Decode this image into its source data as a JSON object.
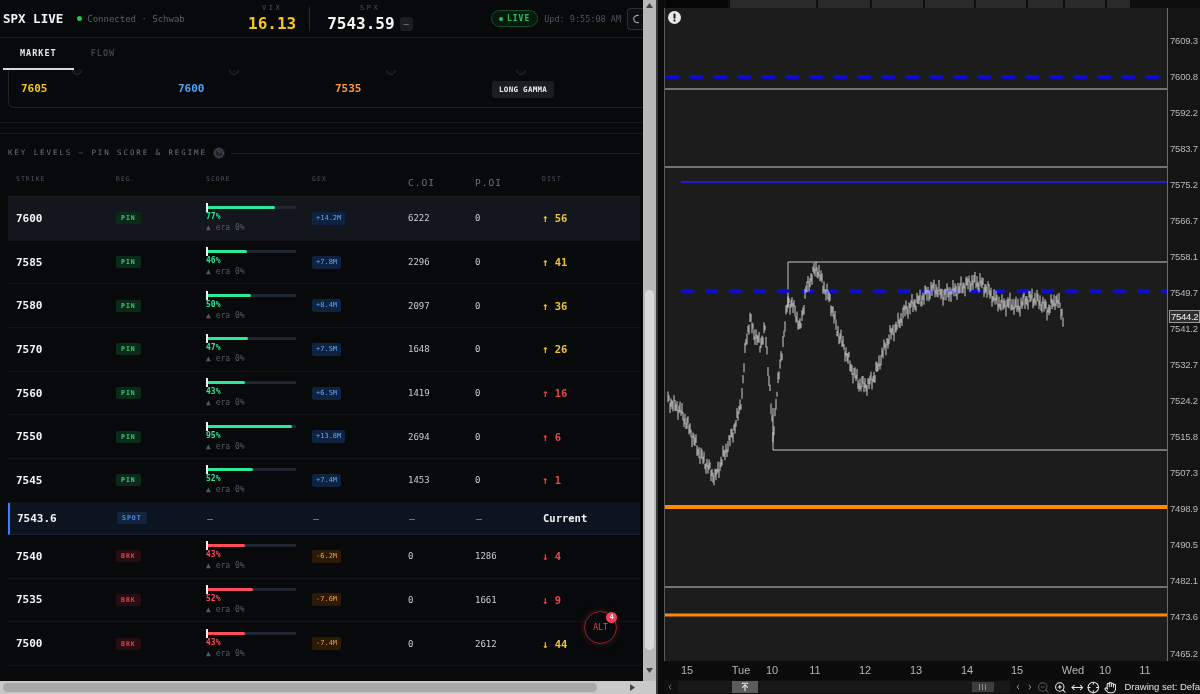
{
  "header": {
    "title": "SPX LIVE",
    "connection": {
      "text": "Connected · Schwab",
      "connected": true
    },
    "quotes": [
      {
        "label": "VIX",
        "value": "16.13",
        "color": "#f5c518"
      },
      {
        "label": "SPX",
        "value": "7543.59",
        "change": "—",
        "color": "#f4f4f4"
      }
    ],
    "live": {
      "label": "LIVE",
      "on": true
    },
    "updated": "Upd: 9:55:08 AM"
  },
  "tabs": [
    {
      "label": "MARKET",
      "selected": true
    },
    {
      "label": "FLOW",
      "selected": false
    }
  ],
  "levels_card": {
    "items": [
      {
        "kind": "value",
        "text": "7605",
        "color": "#f5c518"
      },
      {
        "kind": "value",
        "text": "7600",
        "color": "#4da3ff"
      },
      {
        "kind": "value",
        "text": "7535",
        "color": "#ff9a3c"
      },
      {
        "kind": "badge",
        "text": "LONG GAMMA"
      }
    ]
  },
  "key_levels": {
    "title": "KEY LEVELS — PIN SCORE & REGIME",
    "columns": [
      {
        "label": "STRIKE",
        "kind": "tiny"
      },
      {
        "label": "REG.",
        "kind": "tiny"
      },
      {
        "label": "SCORE",
        "kind": "tiny"
      },
      {
        "label": "GEX",
        "kind": "tiny"
      },
      {
        "label": "C.OI",
        "kind": "plain"
      },
      {
        "label": "P.OI",
        "kind": "plain"
      },
      {
        "label": "DIST",
        "kind": "tiny"
      }
    ],
    "rows": [
      {
        "strike": "7600",
        "kind": "pin",
        "regime": "PIN",
        "highlighted": true,
        "level": 0.77,
        "score": "77%",
        "note": "▲ era 0%",
        "gex": "+14.2M",
        "call_oi": "6222",
        "put_oi": "0",
        "dist": {
          "text": "↑ 56",
          "color": "#f2c230"
        }
      },
      {
        "strike": "7585",
        "kind": "pin",
        "regime": "PIN",
        "highlighted": false,
        "level": 0.46,
        "score": "46%",
        "note": "▲ era 0%",
        "gex": "+7.8M",
        "call_oi": "2296",
        "put_oi": "0",
        "dist": {
          "text": "↑ 41",
          "color": "#f2c230"
        }
      },
      {
        "strike": "7580",
        "kind": "pin",
        "regime": "PIN",
        "highlighted": false,
        "level": 0.5,
        "score": "50%",
        "note": "▲ era 0%",
        "gex": "+8.4M",
        "call_oi": "2097",
        "put_oi": "0",
        "dist": {
          "text": "↑ 36",
          "color": "#f2c230"
        }
      },
      {
        "strike": "7570",
        "kind": "pin",
        "regime": "PIN",
        "highlighted": false,
        "level": 0.47,
        "score": "47%",
        "note": "▲ era 0%",
        "gex": "+7.5M",
        "call_oi": "1648",
        "put_oi": "0",
        "dist": {
          "text": "↑ 26",
          "color": "#f2c230"
        }
      },
      {
        "strike": "7560",
        "kind": "pin",
        "regime": "PIN",
        "highlighted": false,
        "level": 0.43,
        "score": "43%",
        "note": "▲ era 0%",
        "gex": "+6.5M",
        "call_oi": "1419",
        "put_oi": "0",
        "dist": {
          "text": "↑ 16",
          "color": "#e5484d"
        }
      },
      {
        "strike": "7550",
        "kind": "pin",
        "regime": "PIN",
        "highlighted": false,
        "level": 0.95,
        "score": "95%",
        "note": "▲ era 0%",
        "gex": "+13.8M",
        "call_oi": "2694",
        "put_oi": "0",
        "dist": {
          "text": "↑ 6",
          "color": "#e5484d"
        }
      },
      {
        "strike": "7545",
        "kind": "pin",
        "regime": "PIN",
        "highlighted": false,
        "level": 0.52,
        "score": "52%",
        "note": "▲ era 0%",
        "gex": "+7.4M",
        "call_oi": "1453",
        "put_oi": "0",
        "dist": {
          "text": "↑ 1",
          "color": "#e5484d"
        }
      },
      {
        "strike": "7543.6",
        "kind": "spot",
        "regime": "SPOT",
        "highlighted": false,
        "score": "—",
        "gex": "—",
        "call_oi": "—",
        "put_oi": "—",
        "dist": {
          "text": "Current",
          "color": "#f2f2f2"
        }
      },
      {
        "strike": "7540",
        "kind": "brk",
        "regime": "BRK",
        "highlighted": false,
        "level": 0.43,
        "score": "43%",
        "note": "▲ era 0%",
        "gex": "-6.2M",
        "call_oi": "0",
        "put_oi": "1286",
        "dist": {
          "text": "↓ 4",
          "color": "#e5484d"
        }
      },
      {
        "strike": "7535",
        "kind": "brk",
        "regime": "BRK",
        "highlighted": false,
        "level": 0.52,
        "score": "52%",
        "note": "▲ era 0%",
        "gex": "-7.6M",
        "call_oi": "0",
        "put_oi": "1661",
        "dist": {
          "text": "↓ 9",
          "color": "#e5484d"
        }
      },
      {
        "strike": "7500",
        "kind": "brk",
        "regime": "BRK",
        "highlighted": false,
        "level": 0.43,
        "score": "43%",
        "note": "▲ era 0%",
        "gex": "-7.4M",
        "call_oi": "0",
        "put_oi": "2612",
        "dist": {
          "text": "↓ 44",
          "color": "#f2c230"
        }
      }
    ]
  },
  "alert_button": {
    "label": "ALT",
    "count": "4"
  },
  "chart": {
    "price_labels": [
      "7609.3",
      "7600.8",
      "7592.2",
      "7583.7",
      "7575.2",
      "7566.7",
      "7558.1",
      "7549.7",
      "7541.2",
      "7532.7",
      "7524.2",
      "7515.8",
      "7507.3",
      "7498.9",
      "7490.5",
      "7482.1",
      "7473.6",
      "7465.2"
    ],
    "current_price": "7544.2",
    "time_labels": [
      "15",
      "Tue",
      "10",
      "11",
      "12",
      "13",
      "14",
      "15",
      "Wed",
      "10",
      "11"
    ],
    "drawing_set": "Drawing set: Defa"
  }
}
